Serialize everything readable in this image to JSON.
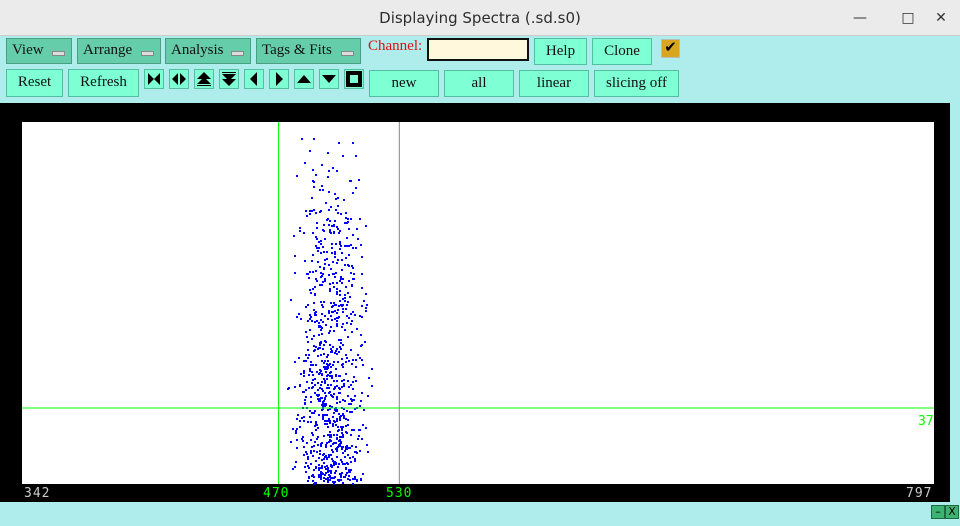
{
  "window": {
    "title": "Displaying Spectra (.sd.s0)"
  },
  "menus": [
    "View",
    "Arrange",
    "Analysis",
    "Tags & Fits"
  ],
  "channel": {
    "label": "Channel:",
    "value": ""
  },
  "buttons": {
    "help": "Help",
    "clone": "Clone",
    "reset": "Reset",
    "refresh": "Refresh",
    "new": "new",
    "all": "all",
    "linear": "linear",
    "slicing": "slicing off"
  },
  "checkbox": {
    "checked": true
  },
  "colors": {
    "points": "#0000ff",
    "markers": "#00ff00",
    "bg": "#afeded"
  },
  "chart_data": {
    "type": "scatter",
    "x_range": [
      342,
      797
    ],
    "x_tick_labels": [
      "342",
      "470",
      "530",
      "797"
    ],
    "x_markers": [
      470,
      530
    ],
    "y_marker_label": "37",
    "point_x_range": [
      472,
      518
    ],
    "note_points": "dense random scatter between x≈472 and x≈518, denser toward bottom"
  }
}
